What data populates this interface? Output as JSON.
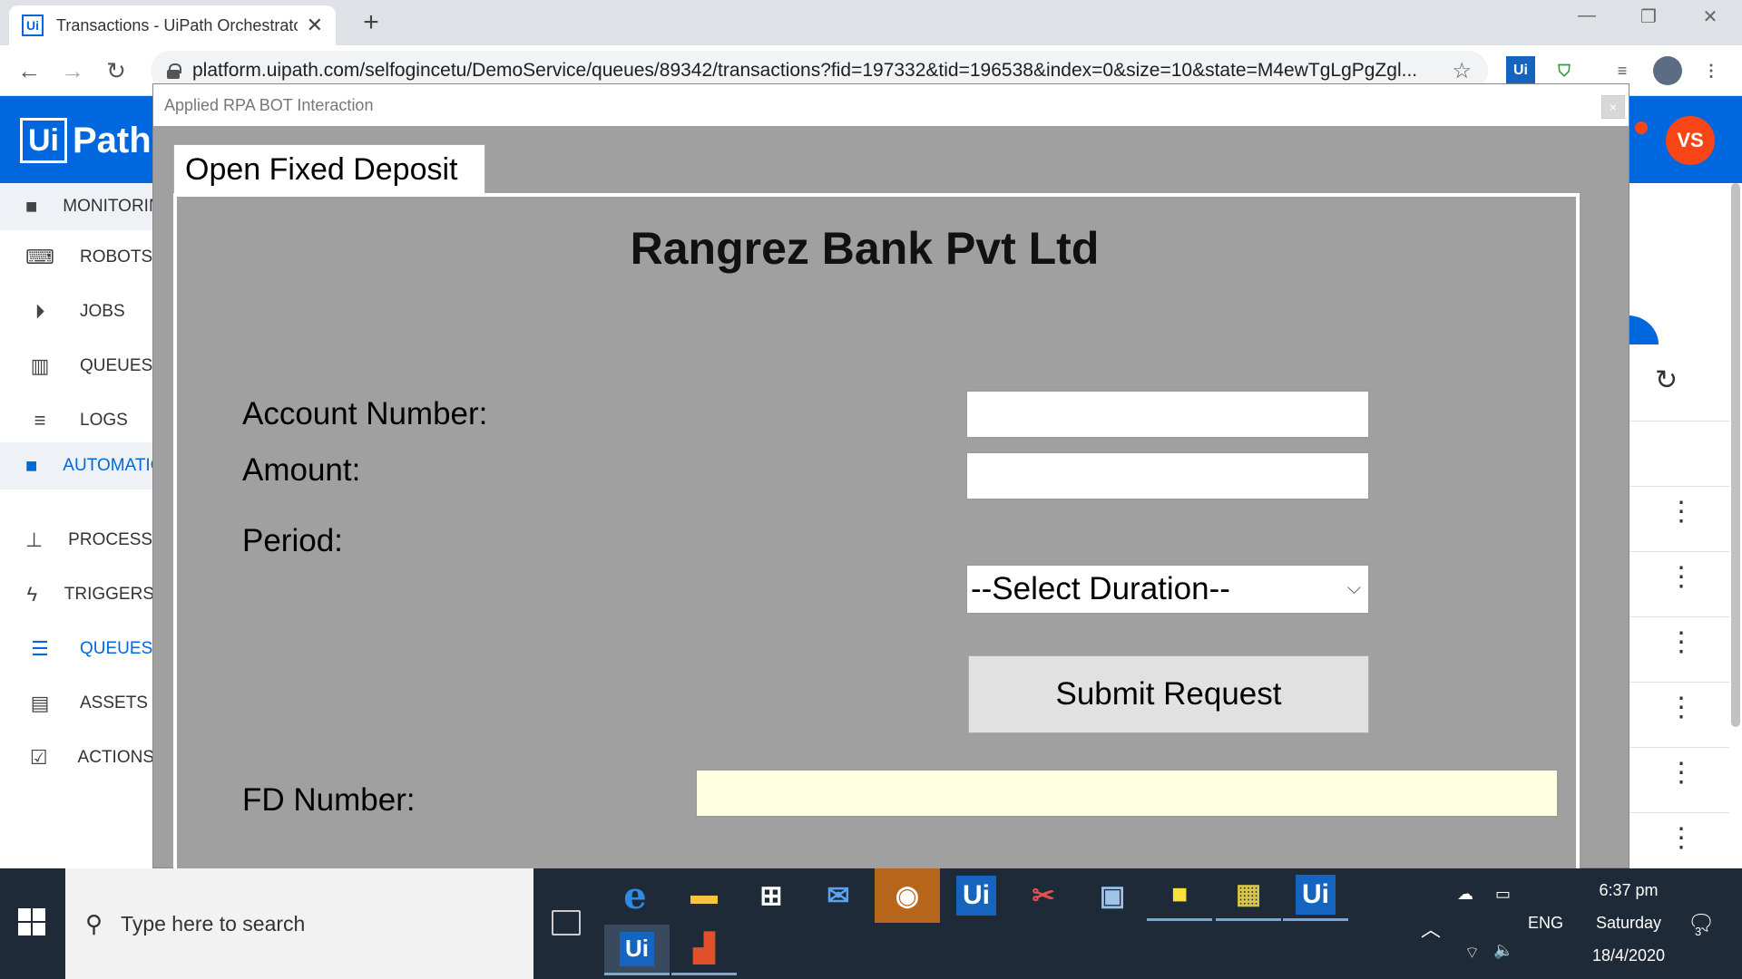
{
  "browser": {
    "tab_title": "Transactions - UiPath Orchestrator",
    "tab_favicon": "Ui",
    "url": "platform.uipath.com/selfogincetu/DemoService/queues/89342/transactions?fid=197332&tid=196538&index=0&size=10&state=M4ewTgLgPgZgl...",
    "ext_uipath": "Ui"
  },
  "orchestrator": {
    "logo_box": "Ui",
    "logo_text": "Path",
    "avatar_initials": "VS",
    "sidebar": [
      {
        "label": "MONITORING",
        "icon": "folder-icon",
        "section": true
      },
      {
        "label": "ROBOTS",
        "icon": "robot-icon"
      },
      {
        "label": "JOBS",
        "icon": "play-icon"
      },
      {
        "label": "QUEUES",
        "icon": "chart-icon"
      },
      {
        "label": "LOGS",
        "icon": "list-icon"
      },
      {
        "label": "AUTOMATIONS",
        "icon": "folder-icon",
        "section": true,
        "active": true
      },
      {
        "label": "PROCESSES",
        "icon": "hierarchy-icon"
      },
      {
        "label": "TRIGGERS",
        "icon": "bolt-icon"
      },
      {
        "label": "QUEUES",
        "icon": "stack-icon",
        "active": true
      },
      {
        "label": "ASSETS",
        "icon": "assets-icon"
      },
      {
        "label": "ACTIONS",
        "icon": "clipboard-icon"
      }
    ]
  },
  "dialog": {
    "window_title": "Applied RPA BOT Interaction",
    "close_glyph": "×",
    "tab_label": "Open Fixed Deposit",
    "bank_title": "Rangrez Bank Pvt Ltd",
    "account_label": "Account Number:",
    "account_value": "",
    "amount_label": "Amount:",
    "amount_value": "",
    "period_label": "Period:",
    "period_selected": "--Select Duration--",
    "submit_label": "Submit Request",
    "fd_label": "FD Number:",
    "fd_value": ""
  },
  "taskbar": {
    "search_placeholder": "Type here to search",
    "time": "6:37 pm",
    "day": "Saturday",
    "date": "18/4/2020",
    "language": "ENG",
    "notification_count": "3",
    "uipath_label": "Ui"
  },
  "colors": {
    "uipath_blue": "#0067df",
    "avatar_orange": "#fa4616",
    "dialog_gray": "#a0a0a0",
    "fd_input_yellow": "#ffffe1",
    "taskbar": "#1f2a38"
  }
}
